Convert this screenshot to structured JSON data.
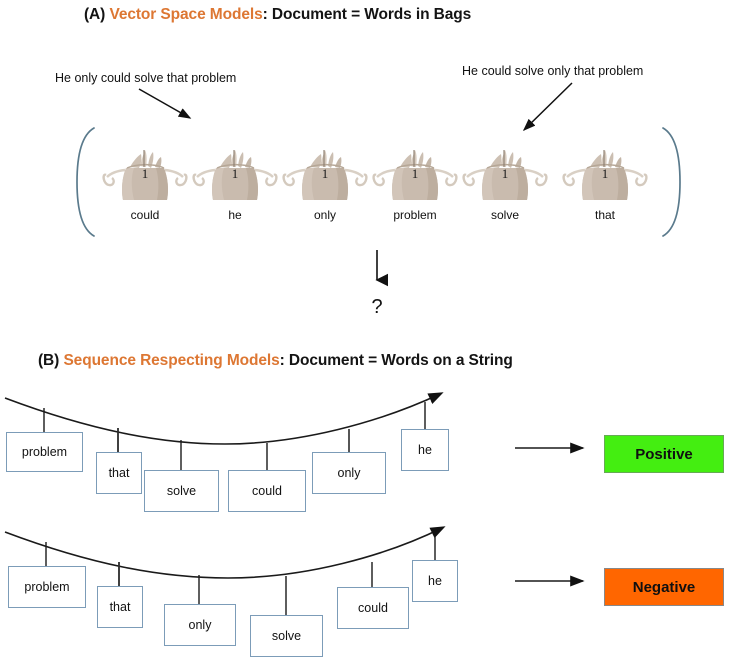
{
  "sections": {
    "a": {
      "tag": "(A) ",
      "accent": "Vector Space Models",
      "rest": ": Document = Words in Bags",
      "caption_left": "He only could solve that problem",
      "caption_right": "He could solve only that problem",
      "bags": [
        {
          "word": "could",
          "count": "1"
        },
        {
          "word": "he",
          "count": "1"
        },
        {
          "word": "only",
          "count": "1"
        },
        {
          "word": "problem",
          "count": "1"
        },
        {
          "word": "solve",
          "count": "1"
        },
        {
          "word": "that",
          "count": "1"
        }
      ],
      "transition_symbol": "?"
    },
    "b": {
      "tag": "(B) ",
      "accent": "Sequence Respecting Models",
      "rest": ": Document = Words on a String",
      "strings": [
        {
          "name": "positive-sentence",
          "words": [
            "problem",
            "that",
            "solve",
            "could",
            "only",
            "he"
          ],
          "outcome": "Positive",
          "outcome_color": "#44ee11"
        },
        {
          "name": "negative-sentence",
          "words": [
            "problem",
            "that",
            "only",
            "solve",
            "could",
            "he"
          ],
          "outcome": "Negative",
          "outcome_color": "#ff6600"
        }
      ]
    }
  },
  "colors": {
    "accent_orange": "#dd7733",
    "bracket_blue": "#5a7a8c",
    "box_border_blue": "#7c9cb8",
    "bag_tan": "#c9bbae",
    "positive_green": "#44ee11",
    "negative_orange": "#ff6600",
    "text_black": "#111111"
  }
}
